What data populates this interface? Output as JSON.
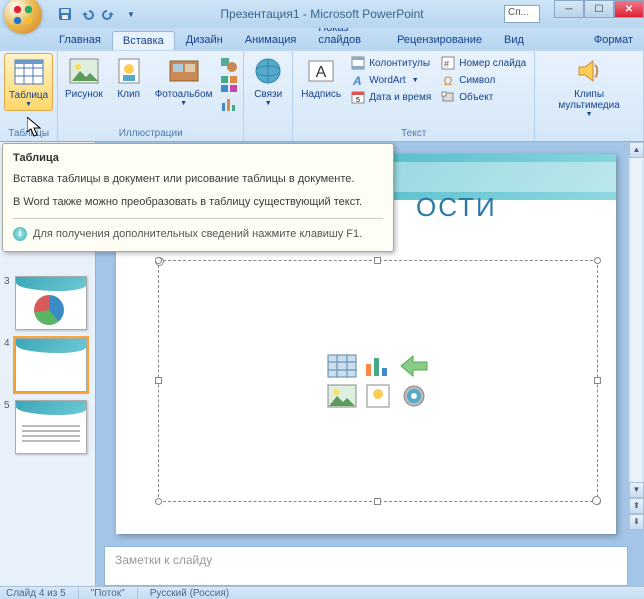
{
  "title": "Презентация1 - Microsoft PowerPoint",
  "search_placeholder": "Сп...",
  "tabs": {
    "home": "Главная",
    "insert": "Вставка",
    "design": "Дизайн",
    "animation": "Анимация",
    "slideshow": "Показ слайдов",
    "review": "Рецензирование",
    "view": "Вид",
    "format": "Формат"
  },
  "ribbon": {
    "tables_group": "Таблицы",
    "table": "Таблица",
    "illustrations_group": "Иллюстрации",
    "picture": "Рисунок",
    "clip": "Клип",
    "photoalbum": "Фотоальбом",
    "links": "Связи",
    "textbox": "Надпись",
    "text_group": "Текст",
    "header_footer": "Колонтитулы",
    "slide_number": "Номер слайда",
    "wordart": "WordArt",
    "symbol": "Символ",
    "date_time": "Дата и время",
    "object": "Объект",
    "media_clips": "Клипы мультимедиа"
  },
  "tooltip": {
    "title": "Таблица",
    "line1": "Вставка таблицы в документ или рисование таблицы в документе.",
    "line2": "В Word также можно преобразовать в таблицу существующий текст.",
    "footer": "Для получения дополнительных сведений нажмите клавишу F1."
  },
  "slide": {
    "title_fragment": "ОСТИ"
  },
  "thumbs": {
    "n3": "3",
    "n4": "4",
    "n5": "5"
  },
  "notes_placeholder": "Заметки к слайду",
  "status": {
    "slide": "Слайд 4 из 5",
    "theme": "\"Поток\"",
    "lang": "Русский (Россия)"
  }
}
